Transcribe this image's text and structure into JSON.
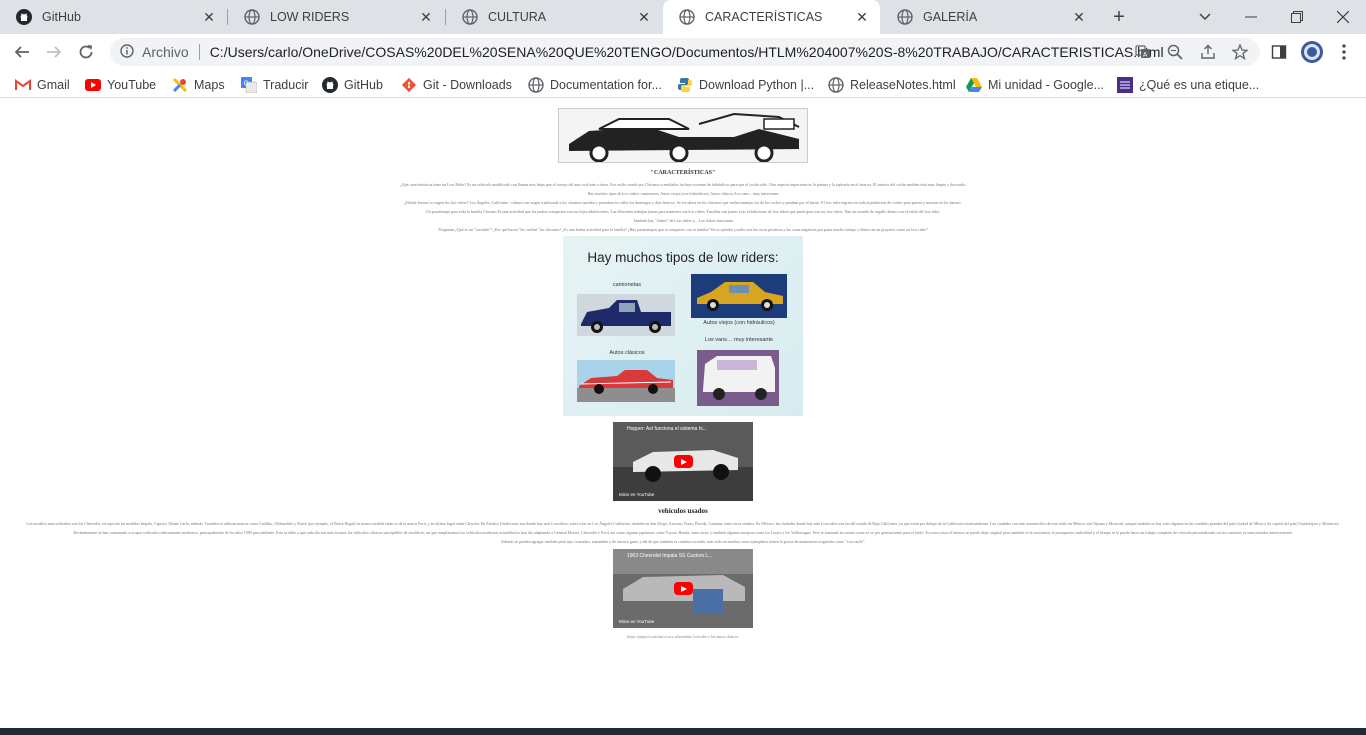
{
  "tabs": [
    {
      "title": "GitHub",
      "icon": "github-icon"
    },
    {
      "title": "LOW RIDERS",
      "icon": "globe-icon"
    },
    {
      "title": "CULTURA",
      "icon": "globe-icon"
    },
    {
      "title": "CARACTERÍSTICAS",
      "icon": "globe-icon",
      "active": true
    },
    {
      "title": "GALERÍA",
      "icon": "globe-icon"
    }
  ],
  "omnibox": {
    "scheme_label": "Archivo",
    "url": "C:/Users/carlo/OneDrive/COSAS%20DEL%20SENA%20QUE%20TENGO/Documentos/HTLM%204007%20S-8%20TRABAJO/CARACTERISTICAS.html"
  },
  "bookmarks": [
    {
      "label": "Gmail",
      "icon": "gmail-icon"
    },
    {
      "label": "YouTube",
      "icon": "youtube-icon"
    },
    {
      "label": "Maps",
      "icon": "maps-icon"
    },
    {
      "label": "Traducir",
      "icon": "translate-icon"
    },
    {
      "label": "GitHub",
      "icon": "github-icon"
    },
    {
      "label": "Git - Downloads",
      "icon": "git-icon"
    },
    {
      "label": "Documentation for...",
      "icon": "globe-icon"
    },
    {
      "label": "Download Python |...",
      "icon": "python-icon"
    },
    {
      "label": "ReleaseNotes.html",
      "icon": "globe-icon"
    },
    {
      "label": "Mi unidad - Google...",
      "icon": "drive-icon"
    },
    {
      "label": "¿Qué es una etique...",
      "icon": "ibm-icon"
    }
  ],
  "page": {
    "title": "\"CARACTERÍSTICAS\"",
    "paragraphs": [
      "¿Qué características tiene un Low Rider? Es un vehículo modificado con llantas más bajas que el cuerpo del auto esté más a tierra. Fue estilo creado por Chicanos a mediados incluye sistemas de hidráulicos para que el coche salte. Otro aspecto importante es la pintura y la tapicería en el interior. El interior del coche también está muy limpio y decorado.",
      "Hay muchos tipos de low riders: camionetas, Autos viejos (con hidráulicos), Autos clásicos Los vans... muy interesante",
      "¿Dónde fueron su origen los low riders? Los Ángeles, California - cultura con origen tradicional a los chicanos nacidos y paseaban en calles los domingos y días festivos. Se los ubica en los chicanos que suelen manejar los de los coches y pasaban por el barrio. El low rider ingresa en toda la población de coches para pasear y mostrar en los barrios.",
      "Un pasatiempo para toda la familia Chicano Es una actividad que los padres comparten con sus hijos adolescentes. Las diferentes trabajan juntas para mantener sus low riders. Familias van juntas a las exhibiciones de low riders que participan con sus low riders. Hay un sentido de orgullo dentro con el estilo del low rider.",
      "También hay \"clubes\" de Low riders y... Los clubes funcionan",
      "Preguntas ¿Qué es un \"carrindo\"? ¿Por qué hacen \"las vueltas\" los chicanos? ¿Es una buena actividad para la familia? ¿Hay pasatiempos que sí compartes con tu familia? En tu opinión ¿cuáles son las cosas positivas y las cosas negativas por pasar mucho tiempo y dinero en un proyecto como un low rider?"
    ],
    "types_panel": {
      "heading": "Hay muchos tipos de low riders:",
      "captions": [
        "camionetas",
        "Autos viejos (con hidráulicos)",
        "Autos clásicos",
        "Los vans… muy interesante"
      ]
    },
    "video1": {
      "title": "Hopper: Así funciona el sistema hi...",
      "brand": "Mirar en YouTube"
    },
    "section_title": "vehículos usados",
    "used_paragraphs": [
      "Los modelos más utilizados son los Chevrolet, en especial los modelos Impala, Caprice, Monte Carlo, además. También se utilizan marcas como Cadillac, Oldsmobile y Buick (por ejemplo, el Buick Regal) en menor medida están se de la marca Ford, y en último lugar están Chrysler. En Estados Unidos más nos donde hay más Lowriders, sobre todo en Los Ángeles California, también en San Diego, Arizona, Texas, Florida, Luisiana, entre otros estados. En México, las ciudades donde hay más Lowriders son las del estado de Baja California, ya que están por debajo de la California estadounidense. Las ciudades con más automóviles de este estilo en México son Tijuana y Mexicali, aunque también se hay visto algunas en las ciudades grandes del país Ciudad de México (la capital del país) Guadalajara y Monterrey.",
      "Recientemente se han comenzado a ocupar vehículos relativamente modernos, principalmente de los años 1980 para adelante. Esto se debe a que cada día son más escasos los vehículos clásicos susceptibles de modificar, así que remplazamos los vehículos modernos actualidad se han ido adaptando a General Motors, Chevrolet y Ford, así como algunas japonesas como Toyota, Honda, entre otras; y también algunas europeas como los Lustes y los Volkswagen. Pero te tomando en cuenta como se ve por generaciones para el estilo. Es estos casos el interior se puede dejar original pero también se le customiza, el presupuesto individual y el tiempo se le puede hacer un trabajo completo de creación personalizada con los sistemas ya mencionados anteriormente.",
      "Además se pueden agregar también pulir tipo cromados, ensamblar y de nuestro gusto y del de que también es cambiar su estilo, más todo en muchos casos ejemplares tienen la gracia de mantenerse originales como \"a su estilo\"."
    ],
    "video2": {
      "title": "1963 Chevrolet Impala SS Custom L...",
      "brand": "Mirar en YouTube"
    },
    "credit": "https://pngset.com/imf.ct.mx.wikimedia/ lowrider y los autos clasicos"
  }
}
